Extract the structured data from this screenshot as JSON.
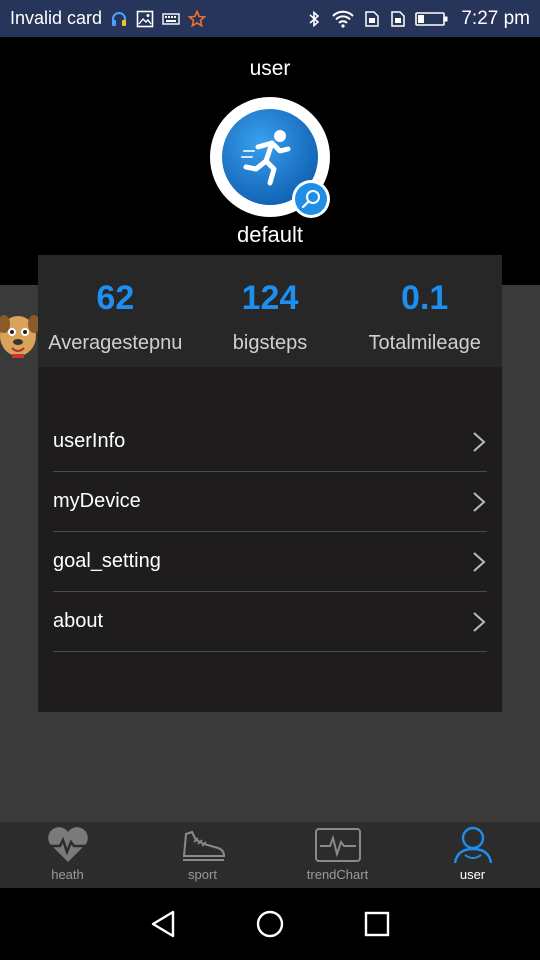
{
  "status_bar": {
    "carrier": "Invalid card",
    "time": "7:27 pm",
    "icons_left": [
      "headset-icon",
      "image-icon",
      "keyboard-icon",
      "star-icon"
    ],
    "icons_right": [
      "bluetooth-icon",
      "wifi-icon",
      "sim1-icon",
      "sim2-icon",
      "battery-icon"
    ]
  },
  "header": {
    "title": "user",
    "username": "default",
    "avatar_icon": "runner-icon",
    "badge_icon": "edit-icon"
  },
  "stats": [
    {
      "value": "62",
      "label": "Averagestepnu"
    },
    {
      "value": "124",
      "label": "bigsteps"
    },
    {
      "value": "0.1",
      "label": "Totalmileage"
    }
  ],
  "menu": [
    {
      "label": "userInfo"
    },
    {
      "label": "myDevice"
    },
    {
      "label": "goal_setting"
    },
    {
      "label": "about"
    }
  ],
  "tabs": [
    {
      "label": "heath",
      "icon": "heart-icon",
      "active": false
    },
    {
      "label": "sport",
      "icon": "shoe-icon",
      "active": false
    },
    {
      "label": "trendChart",
      "icon": "chart-icon",
      "active": false
    },
    {
      "label": "user",
      "icon": "user-icon",
      "active": true
    }
  ],
  "colors": {
    "accent": "#1d8ff0",
    "status_bar": "#28355a",
    "panel": "#1e1c1d",
    "background": "#3a3a3a"
  }
}
